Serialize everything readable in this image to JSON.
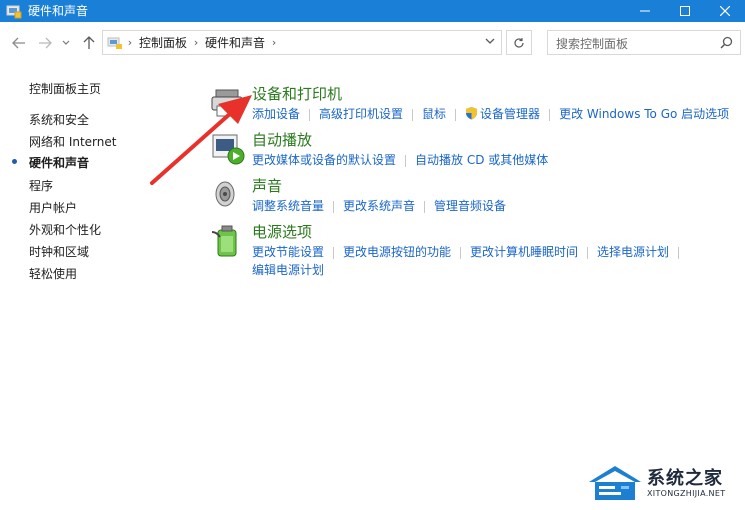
{
  "window": {
    "title": "硬件和声音"
  },
  "address": {
    "crumbs": [
      "控制面板",
      "硬件和声音"
    ],
    "search_placeholder": "搜索控制面板"
  },
  "sidebar": {
    "items": [
      {
        "label": "控制面板主页",
        "active": false
      },
      {
        "label": "系统和安全",
        "active": false
      },
      {
        "label": "网络和 Internet",
        "active": false
      },
      {
        "label": "硬件和声音",
        "active": true
      },
      {
        "label": "程序",
        "active": false
      },
      {
        "label": "用户帐户",
        "active": false
      },
      {
        "label": "外观和个性化",
        "active": false
      },
      {
        "label": "时钟和区域",
        "active": false
      },
      {
        "label": "轻松使用",
        "active": false
      }
    ]
  },
  "categories": [
    {
      "heading": "设备和打印机",
      "icon": "printer-icon",
      "links": [
        "添加设备",
        "高级打印机设置",
        "鼠标",
        "设备管理器",
        "更改 Windows To Go 启动选项"
      ]
    },
    {
      "heading": "自动播放",
      "icon": "autoplay-icon",
      "links": [
        "更改媒体或设备的默认设置",
        "自动播放 CD 或其他媒体"
      ]
    },
    {
      "heading": "声音",
      "icon": "speaker-icon",
      "links": [
        "调整系统音量",
        "更改系统声音",
        "管理音频设备"
      ]
    },
    {
      "heading": "电源选项",
      "icon": "battery-icon",
      "links": [
        "更改节能设置",
        "更改电源按钮的功能",
        "更改计算机睡眠时间",
        "选择电源计划"
      ],
      "links_row2": [
        "编辑电源计划"
      ]
    }
  ],
  "watermark": {
    "name": "系统之家",
    "domain": "XITONGZHIJIA.NET"
  },
  "colors": {
    "titlebar": "#1a7fd6",
    "heading_green": "#2b7a1e",
    "link_blue": "#1a66c9",
    "arrow_red": "#e8312a"
  }
}
